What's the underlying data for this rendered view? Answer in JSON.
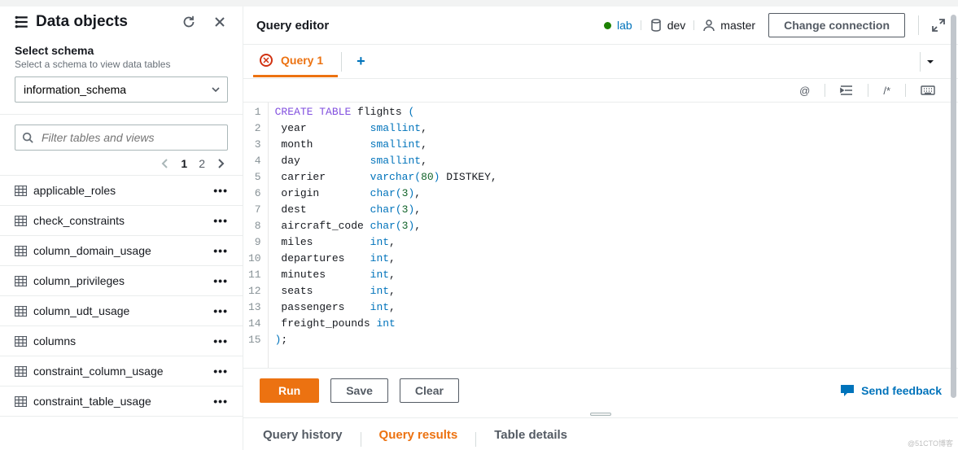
{
  "sidebar": {
    "title": "Data objects",
    "schema_label": "Select schema",
    "schema_help": "Select a schema to view data tables",
    "schema_value": "information_schema",
    "filter_placeholder": "Filter tables and views",
    "page_1": "1",
    "page_2": "2",
    "tables": [
      "applicable_roles",
      "check_constraints",
      "column_domain_usage",
      "column_privileges",
      "column_udt_usage",
      "columns",
      "constraint_column_usage",
      "constraint_table_usage"
    ]
  },
  "header": {
    "title": "Query editor",
    "lab": "lab",
    "dev": "dev",
    "master": "master",
    "change_conn": "Change connection"
  },
  "tabs": {
    "query1": "Query 1"
  },
  "toolbar": {
    "at": "@",
    "comment": "/*"
  },
  "code": {
    "l1a": "CREATE",
    "l1b": "TABLE",
    "l1c": " flights ",
    "l1d": "(",
    "l2a": " year          ",
    "l2b": "smallint",
    "l2c": ",",
    "l3a": " month         ",
    "l3b": "smallint",
    "l3c": ",",
    "l4a": " day           ",
    "l4b": "smallint",
    "l4c": ",",
    "l5a": " carrier       ",
    "l5b": "varchar",
    "l5p1": "(",
    "l5n": "80",
    "l5p2": ")",
    "l5c": " DISTKEY,",
    "l6a": " origin        ",
    "l6b": "char",
    "l6p1": "(",
    "l6n": "3",
    "l6p2": ")",
    "l6c": ",",
    "l7a": " dest          ",
    "l7b": "char",
    "l7p1": "(",
    "l7n": "3",
    "l7p2": ")",
    "l7c": ",",
    "l8a": " aircraft_code ",
    "l8b": "char",
    "l8p1": "(",
    "l8n": "3",
    "l8p2": ")",
    "l8c": ",",
    "l9a": " miles         ",
    "l9b": "int",
    "l9c": ",",
    "l10a": " departures    ",
    "l10b": "int",
    "l10c": ",",
    "l11a": " minutes       ",
    "l11b": "int",
    "l11c": ",",
    "l12a": " seats         ",
    "l12b": "int",
    "l12c": ",",
    "l13a": " passengers    ",
    "l13b": "int",
    "l13c": ",",
    "l14a": " freight_pounds ",
    "l14b": "int",
    "l15a": ")",
    "l15b": ";"
  },
  "actions": {
    "run": "Run",
    "save": "Save",
    "clear": "Clear",
    "feedback": "Send feedback"
  },
  "bottom": {
    "history": "Query history",
    "results": "Query results",
    "details": "Table details"
  },
  "linenums": [
    "1",
    "2",
    "3",
    "4",
    "5",
    "6",
    "7",
    "8",
    "9",
    "10",
    "11",
    "12",
    "13",
    "14",
    "15"
  ]
}
